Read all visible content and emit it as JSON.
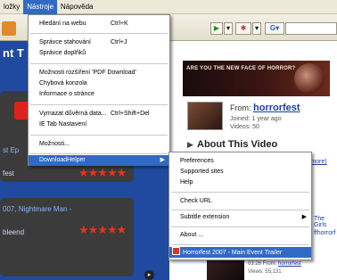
{
  "menubar": {
    "items": [
      "ložky",
      "Nástroje",
      "Nápověda"
    ]
  },
  "page": {
    "left_title": "nt T",
    "left_items": [
      {
        "title": "st Ep",
        "meta": "fest"
      },
      {
        "title": "007, Nightmare Man -",
        "meta": "bleend"
      }
    ],
    "banner_text": "ARE YOU THE NEW FACE OF HORROR?",
    "from_label": "From:",
    "from_user": "horrorfest",
    "joined": "Joined: 1 year ago",
    "videos": "Videos: 50",
    "about_title": "About This Video",
    "more_link": "(more)",
    "right_snippet_1": "The Girls",
    "right_snippet_2": "ffhorrorf",
    "video_duration": "03:26 From:",
    "video_user": "horrorfest",
    "video_views": "Views: 55,131",
    "video_from2": "From: horrorfest"
  },
  "tools_menu": {
    "items": [
      {
        "label": "Hledání na webu",
        "shortcut": "Ctrl+K"
      },
      {
        "label": "Správce stahování",
        "shortcut": "Ctrl+J"
      },
      {
        "label": "Správce doplňků",
        "shortcut": ""
      },
      {
        "label": "Možnosti rozšíření 'PDF Download'",
        "shortcut": ""
      },
      {
        "label": "Chybová konzola",
        "shortcut": ""
      },
      {
        "label": "Informace o stránce",
        "shortcut": ""
      },
      {
        "label": "Vymazat důvěrná data...",
        "shortcut": "Ctrl+Shift+Del"
      },
      {
        "label": "IE Tab Nastavení",
        "shortcut": ""
      },
      {
        "label": "Možnosti...",
        "shortcut": ""
      },
      {
        "label": "DownloadHelper",
        "shortcut": ""
      }
    ]
  },
  "downloadhelper_menu": {
    "items": [
      {
        "label": "Preferences"
      },
      {
        "label": "Supported sites"
      },
      {
        "label": "Help"
      },
      {
        "label": "Check URL"
      },
      {
        "label": "Subtitle extension"
      },
      {
        "label": "About ..."
      },
      {
        "label": "Horrorfest 2007 - Main Event Trailer"
      }
    ]
  },
  "colors": {
    "highlight": "#316ac5",
    "page_blue": "#1f4aa0",
    "stars": "#e8321c"
  }
}
